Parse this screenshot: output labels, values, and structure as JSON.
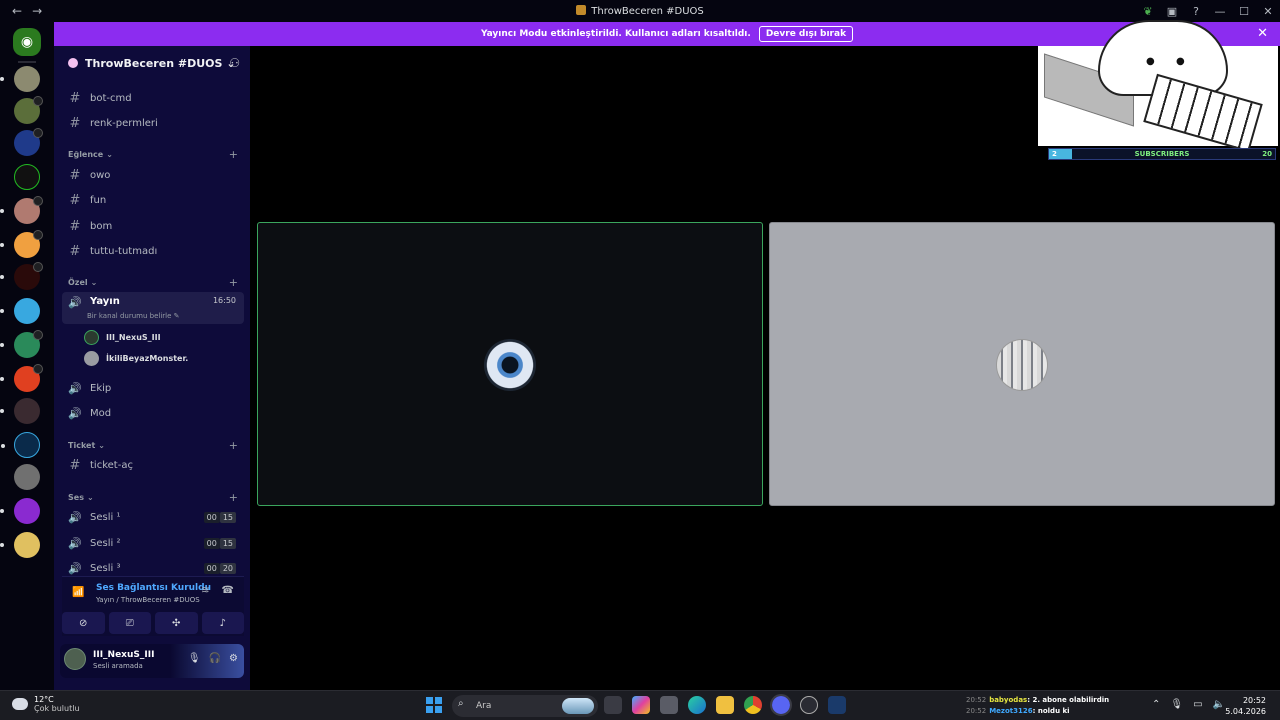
{
  "window": {
    "title": "ThrowBeceren #DUOS"
  },
  "banner": {
    "text": "Yayıncı Modu etkinleştirildi. Kullanıcı adları kısaltıldı.",
    "button_label": "Devre dışı bırak",
    "close": "✕"
  },
  "guild": {
    "name": "ThrowBeceren #DUOS"
  },
  "channels": {
    "bot_cmd": "bot-cmd",
    "renk_permleri": "renk-permleri",
    "cat_eglence": "Eğlence",
    "owo": "owo",
    "fun": "fun",
    "bom": "bom",
    "tuttu": "tuttu-tutmadı",
    "cat_ozel": "Özel",
    "yayin": "Yayın",
    "yayin_time": "16:50",
    "yayin_status": "Bir kanal durumu belirle",
    "voice_user_1": "III_NexuS_III",
    "voice_user_2": "İkiliBeyazMonster.",
    "ekip": "Ekip",
    "mod": "Mod",
    "cat_ticket": "Ticket",
    "ticket_ac": "ticket-aç",
    "cat_ses": "Ses",
    "sesli1": "Sesli ¹",
    "sesli2": "Sesli ²",
    "sesli3": "Sesli ³",
    "c1a": "00",
    "c1b": "15",
    "c2a": "00",
    "c2b": "15",
    "c3a": "00",
    "c3b": "20"
  },
  "voice_panel": {
    "status": "Ses Bağlantısı Kuruldu",
    "location": "Yayın / ThrowBeceren #DUOS"
  },
  "user": {
    "name": "III_NexuS_III",
    "status": "Sesli aramada"
  },
  "overlay": {
    "subscribers_label": "SUBSCRIBERS",
    "current": "2",
    "goal": "20",
    "progress": 0.1
  },
  "taskbar": {
    "temp": "12°C",
    "weather": "Çok bulutlu",
    "search_placeholder": "Ara",
    "chat": [
      {
        "time": "20:52",
        "user": "babyodas",
        "message": ": 2. abone olabilirdin"
      },
      {
        "time": "20:52",
        "user": "Mezot3126",
        "message": ": noldu ki"
      }
    ],
    "time": "20:52",
    "date": "5.04.2026"
  },
  "colors": {
    "banner": "#8c2cf0",
    "sidebar": "#0e0b3a",
    "speaking": "#3ba55d"
  }
}
